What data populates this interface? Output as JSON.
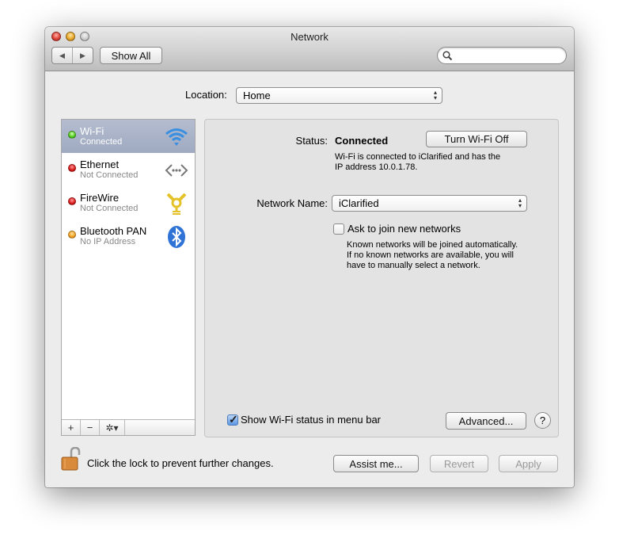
{
  "window": {
    "title": "Network"
  },
  "toolbar": {
    "back_icon": "◀",
    "forward_icon": "▶",
    "show_all_label": "Show All",
    "search_placeholder": "",
    "search_icon": "⚲"
  },
  "location": {
    "label": "Location:",
    "value": "Home"
  },
  "services": [
    {
      "name": "Wi-Fi",
      "status": "Connected",
      "indicator": "green",
      "icon": "wifi-icon",
      "selected": true
    },
    {
      "name": "Ethernet",
      "status": "Not Connected",
      "indicator": "red",
      "icon": "ethernet-icon",
      "selected": false
    },
    {
      "name": "FireWire",
      "status": "Not Connected",
      "indicator": "red",
      "icon": "firewire-icon",
      "selected": false
    },
    {
      "name": "Bluetooth PAN",
      "status": "No IP Address",
      "indicator": "orange",
      "icon": "bluetooth-icon",
      "selected": false
    }
  ],
  "sidebar_footer": {
    "add": "+",
    "remove": "−",
    "gear": "✲▾"
  },
  "detail": {
    "status_label": "Status:",
    "status_value": "Connected",
    "turn_off_label": "Turn Wi-Fi Off",
    "status_desc_line1": "Wi-Fi is connected to iClarified and has the",
    "status_desc_line2": "IP address 10.0.1.78.",
    "network_name_label": "Network Name:",
    "network_name_value": "iClarified",
    "ask_join_label": "Ask to join new networks",
    "ask_join_checked": false,
    "ask_join_desc_line1": "Known networks will be joined automatically.",
    "ask_join_desc_line2": "If no known networks are available, you will",
    "ask_join_desc_line3": "have to manually select a network.",
    "show_status_label": "Show Wi-Fi status in menu bar",
    "show_status_checked": true,
    "advanced_label": "Advanced...",
    "help_label": "?"
  },
  "footer": {
    "lock_text": "Click the lock to prevent further changes.",
    "assist_label": "Assist me...",
    "revert_label": "Revert",
    "apply_label": "Apply"
  },
  "colors": {
    "selection": "#a9b3c8",
    "connected": "#4fcb1d",
    "disconnected": "#d81818",
    "no_ip": "#f4a020",
    "checkbox_on": "#5b98e4"
  }
}
